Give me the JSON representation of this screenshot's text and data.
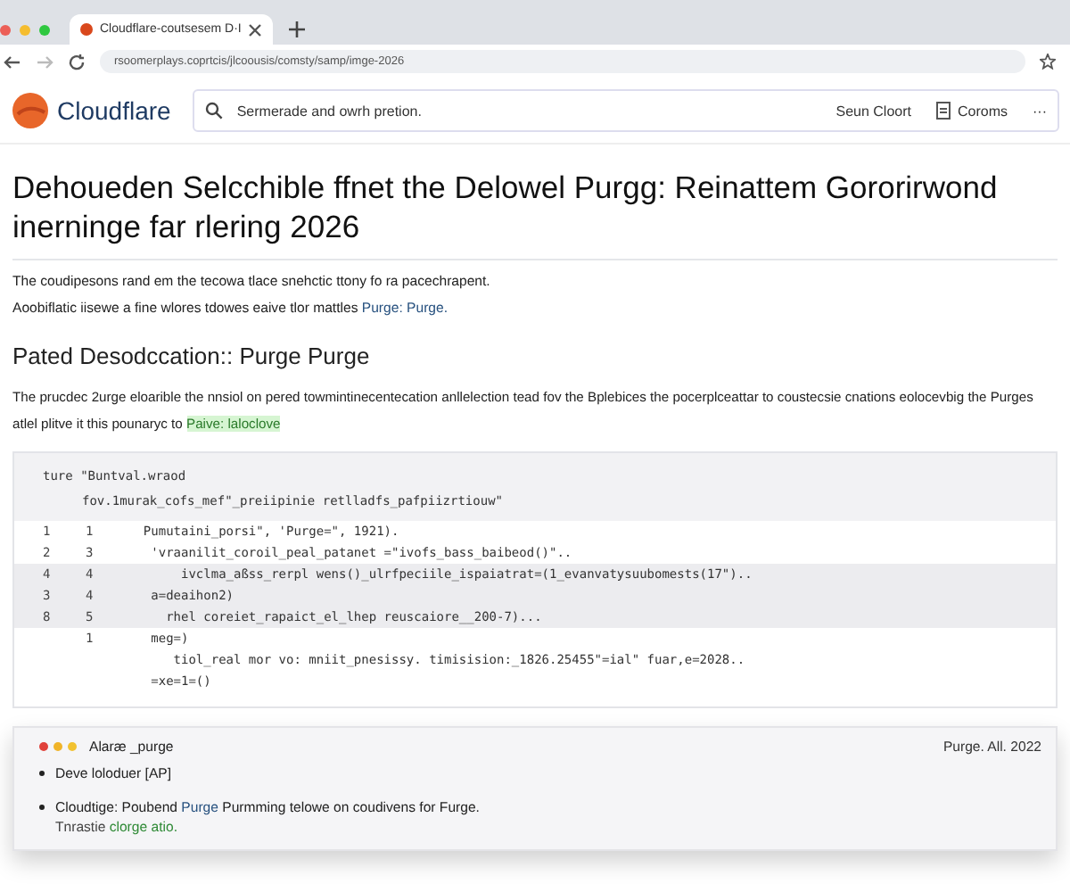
{
  "browser": {
    "tab_title": "Cloudflare-coutsesem D·I",
    "url": "rsoomerplays.coprtcis/jlcoousis/comsty/samp/imge-2026"
  },
  "site": {
    "logo_text": "Cloudflare",
    "search": {
      "placeholder": "Sermerade and owrh pretion."
    },
    "nav": [
      {
        "label": "Seun Cloort",
        "kind": "text"
      },
      {
        "label": "Coroms",
        "kind": "doc"
      }
    ],
    "more": "···"
  },
  "title": "Dehoueden Selcchible ffnet the Delowel Purgg: Reinattem Gororirwond inerninge far rlering 2026",
  "intro": [
    [
      {
        "text": "The coudipesons rand em the tecowa tlace snehctic ttony fo ra pacechrapent.",
        "kind": "plain"
      }
    ],
    [
      {
        "text": "Aoobiflatic iisewe a fine wlores tdowes eaive tlor mattles ",
        "kind": "plain"
      },
      {
        "text": "Purge: Purge.",
        "kind": "link"
      }
    ]
  ],
  "section": {
    "heading": "Pated Desodccation:: Purge Purge",
    "paragraph": [
      {
        "text": "The prucdec 2urge  eloarible the nnsiol on pered towmintinecentecation anllelection tead fov the Bplebices the pocerplceattar to coustecsie cnations eolocevbig the Purges atlel plitve it this pounaryc to ",
        "kind": "plain"
      },
      {
        "text": "Paive: laloclove",
        "kind": "highlight"
      }
    ]
  },
  "code": {
    "header": [
      "ture \"Buntval.wraod",
      "fov.1murak_cofs_mef\"_preiipinie retlladfs_pafpiizrtiouw\""
    ],
    "lines": [
      {
        "n1": "1",
        "n2": "1",
        "text": "  Pumutaini_porsi\", 'Purge=\", 1921).",
        "shaded": false
      },
      {
        "n1": "2",
        "n2": "3",
        "text": "   'vraanilit_coroil_peal_patanet =\"ivofs_bass_baibeod()\"..",
        "shaded": false
      },
      {
        "n1": "4",
        "n2": "4",
        "text": "       ivclma_aßss_rerpl wens()_ulrfpeciile_ispaiatrat=(1_evanvatysuubomests(17\")..",
        "shaded": true
      },
      {
        "n1": "3",
        "n2": "4",
        "text": "   a=deaihon2)",
        "shaded": true
      },
      {
        "n1": "8",
        "n2": "5",
        "text": "     rhel coreiet_rapaict_el_lhep reuscaiore__200-7)...",
        "shaded": true
      },
      {
        "n2": "1",
        "text": "   meg=)",
        "shaded": false
      },
      {
        "text": "      tiol_real mor vo: mniit_pnesissy. timisision:_1826.25455\"=ial\" fuar,e=2028..",
        "shaded": false
      },
      {
        "text": "   =xe=1=()",
        "shaded": false
      }
    ]
  },
  "alert": {
    "title": "Alaræ _purge",
    "date": "Purge. All. 2022",
    "dots": [
      {
        "color": "#e0413a"
      },
      {
        "color": "#f0b429"
      },
      {
        "color": "#f2c230"
      }
    ],
    "items": [
      [
        {
          "text": "Deve loloduer [AP]",
          "kind": "plain"
        }
      ],
      [
        {
          "text": "Cloudtige: Poubend ",
          "kind": "plain"
        },
        {
          "text": "Purge",
          "kind": "link"
        },
        {
          "text": " Purmming telowe on coudivens for Furge.",
          "kind": "plain"
        }
      ]
    ],
    "note": [
      {
        "text": "Tnrastie ",
        "kind": "plain"
      },
      {
        "text": "clorge atio.",
        "kind": "green"
      }
    ]
  }
}
